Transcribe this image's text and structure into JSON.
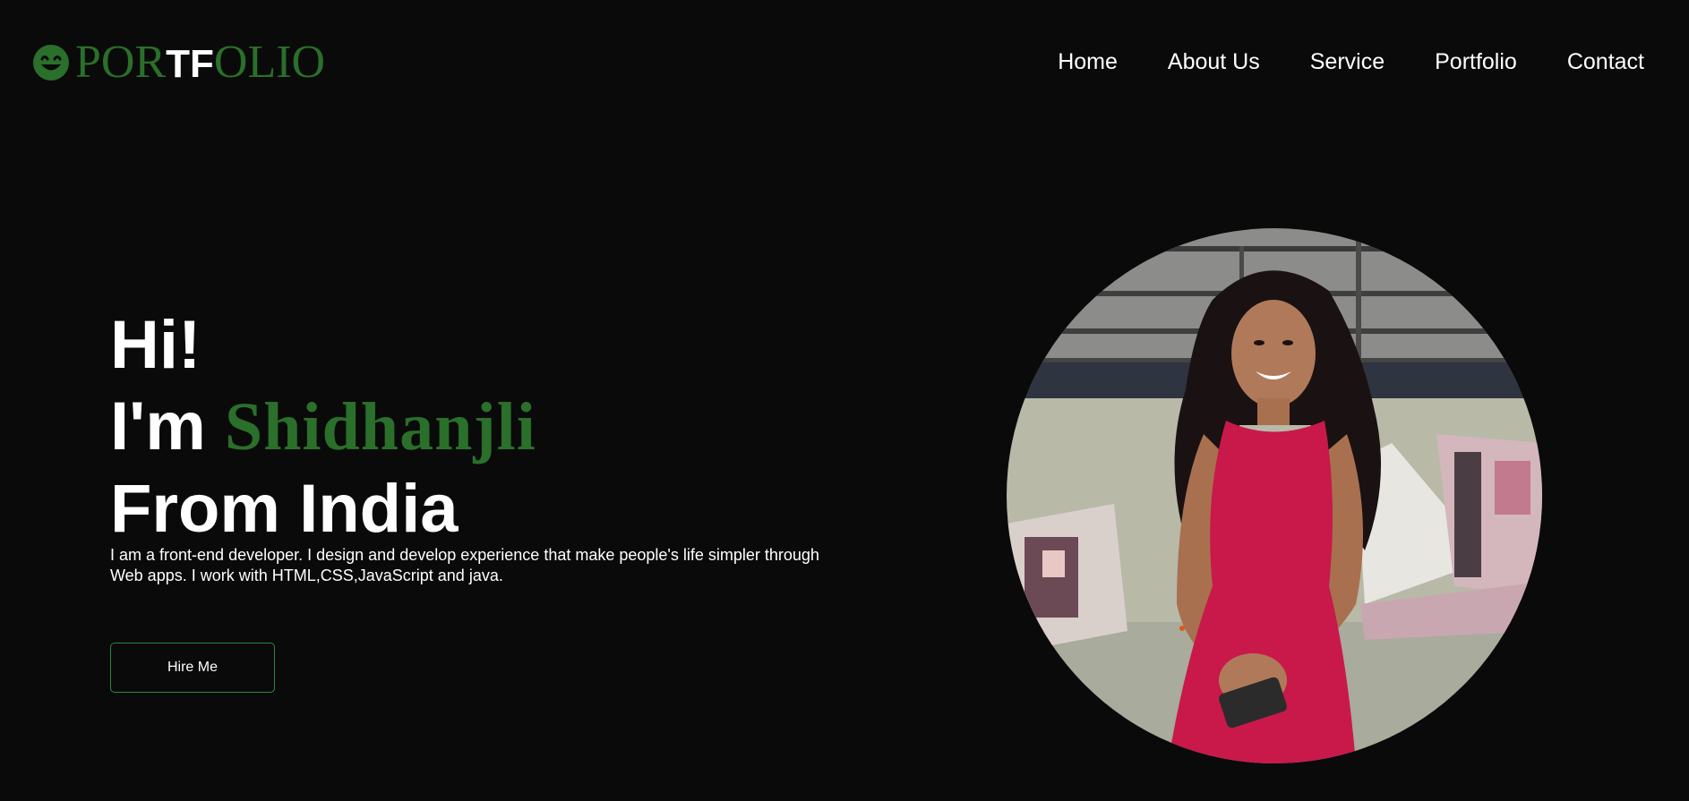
{
  "logo": {
    "part1": "POR",
    "part2": "TF",
    "part3": "OLIO",
    "icon": "smiley-icon",
    "accent_color": "#2a6f2a"
  },
  "nav": {
    "items": [
      {
        "label": "Home"
      },
      {
        "label": "About Us"
      },
      {
        "label": "Service"
      },
      {
        "label": "Portfolio"
      },
      {
        "label": "Contact"
      }
    ]
  },
  "hero": {
    "greeting": "Hi!",
    "intro_prefix": "I'm ",
    "name": "Shidhanjli",
    "location_line": "From India",
    "description": "I am a front-end developer. I design and develop experience that make people's life simpler through Web apps. I work with HTML,CSS,JavaScript and java.",
    "cta_label": "Hire Me",
    "cta_border_color": "#2a8a3a"
  },
  "colors": {
    "background": "#0a0a0a",
    "text": "#ffffff",
    "accent": "#2a6f2a"
  }
}
